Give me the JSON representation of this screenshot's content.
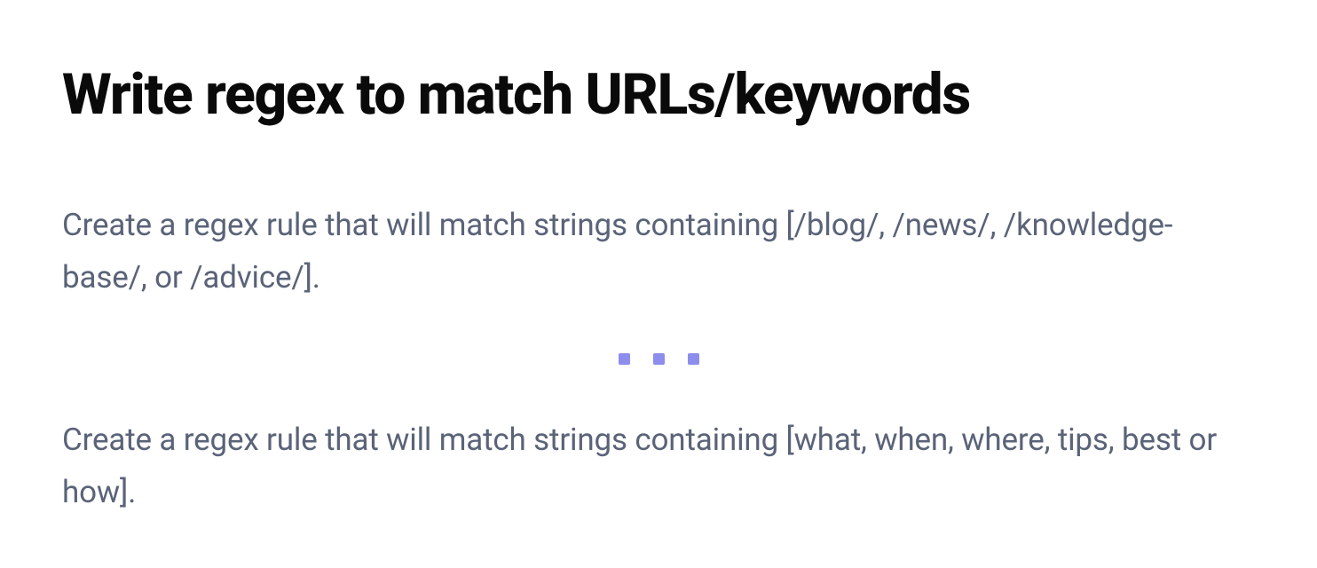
{
  "title": "Write regex to match URLs/keywords",
  "paragraph1": "Create a regex rule that will match strings containing [/blog/, /news/, /knowledge-base/, or /advice/].",
  "paragraph2": "Create a regex rule that will match strings containing [what, when, where, tips, best or how]."
}
